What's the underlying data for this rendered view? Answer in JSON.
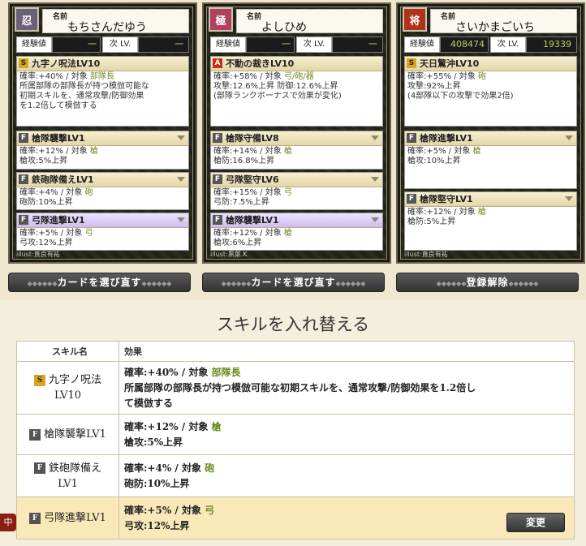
{
  "cards": [
    {
      "crest": "忍",
      "name_label": "名前",
      "name": "もちさんだゆう",
      "exp_label": "経験値",
      "exp_value": "一",
      "next_label": "次 LV.",
      "next_value": "一",
      "skills": [
        {
          "grade": "S",
          "title": "九字ノ呪法LV10",
          "lines": [
            "確率:+40% / 対象 部隊長",
            "所属部隊の部隊長が持つ模倣可能な",
            "初期スキルを、通常攻撃/防御効果",
            "を1.2倍して模倣する"
          ]
        },
        {
          "grade": "F",
          "title": "槍隊襲撃LV1",
          "lines": [
            "確率:+12% / 対象 槍",
            "槍攻:5%上昇"
          ]
        },
        {
          "grade": "F",
          "title": "鉄砲隊備えLV1",
          "lines": [
            "確率:+4% / 対象 砲",
            "砲防:10%上昇"
          ]
        },
        {
          "grade": "F",
          "title": "弓隊進撃LV1",
          "lines": [
            "確率:+5% / 対象 弓",
            "弓攻:12%上昇"
          ]
        }
      ],
      "illust": "illust:直良有祐"
    },
    {
      "crest": "極",
      "name_label": "名前",
      "name": "よしひめ",
      "exp_label": "経験値",
      "exp_value": "一",
      "next_label": "次 LV.",
      "next_value": "一",
      "skills": [
        {
          "grade": "A",
          "title": "不動の裁きLV10",
          "lines": [
            "確率:+58% / 対象 弓/砲/器",
            "攻撃:12.6%上昇 防御:12.6%上昇",
            "(部隊ランクボーナスで効果が変化)"
          ]
        },
        {
          "grade": "F",
          "title": "槍隊守備LV8",
          "lines": [
            "確率:+14% / 対象 槍",
            "槍防:16.8%上昇"
          ]
        },
        {
          "grade": "F",
          "title": "弓隊堅守LV6",
          "lines": [
            "確率:+15% / 対象 弓",
            "弓防:7.5%上昇"
          ]
        },
        {
          "grade": "F",
          "title": "槍隊襲撃LV1",
          "lines": [
            "確率:+12% / 対象 槍",
            "槍攻:6%上昇"
          ]
        }
      ],
      "illust": "illust:黒葉.K"
    },
    {
      "crest": "将",
      "name_label": "名前",
      "name": "さいかまごいち",
      "exp_label": "経験値",
      "exp_value": "408474",
      "next_label": "次 LV.",
      "next_value": "19339",
      "skills": [
        {
          "grade": "S",
          "title": "天日驚沖LV10",
          "lines": [
            "確率:+55% / 対象 砲",
            "攻撃:92%上昇",
            "(4部隊以下の攻撃で効果2倍)"
          ]
        },
        {
          "grade": "F",
          "title": "槍隊進撃LV1",
          "lines": [
            "確率:+5% / 対象 槍",
            "槍攻:10%上昇"
          ]
        },
        {
          "grade": "F",
          "title": "槍隊堅守LV1",
          "lines": [
            "確率:+12% / 対象 槍",
            "槍防:5%上昇"
          ]
        }
      ],
      "illust": "illust:直良有祐"
    }
  ],
  "buttons": {
    "reselect1": "カードを選び直す",
    "reselect2": "カードを選び直す",
    "unregister": "登録解除",
    "dots": "◆◆◆◆◆◆"
  },
  "section": {
    "title": "スキルを入れ替える",
    "col_skill": "スキル名",
    "col_effect": "効果",
    "rows": [
      {
        "grade": "S",
        "name1": "九字ノ呪法",
        "name2": "LV10",
        "lines": [
          "確率:+40% / 対象 部隊長",
          "所属部隊の部隊長が持つ模倣可能な初期スキルを、通常攻撃/防御効果を1.2倍し",
          "て模倣する"
        ]
      },
      {
        "grade": "F",
        "name1": "槍隊襲撃LV1",
        "name2": "",
        "lines": [
          "確率:+12% / 対象 槍",
          "槍攻:5%上昇"
        ]
      },
      {
        "grade": "F",
        "name1": "鉄砲隊備え",
        "name2": "LV1",
        "lines": [
          "確率:+4% / 対象 砲",
          "砲防:10%上昇"
        ]
      },
      {
        "grade": "F",
        "name1": "弓隊進撃LV1",
        "name2": "",
        "lines": [
          "確率:+5% / 対象 弓",
          "弓攻:12%上昇"
        ]
      }
    ],
    "change_button": "変更",
    "side_tag": "中"
  }
}
